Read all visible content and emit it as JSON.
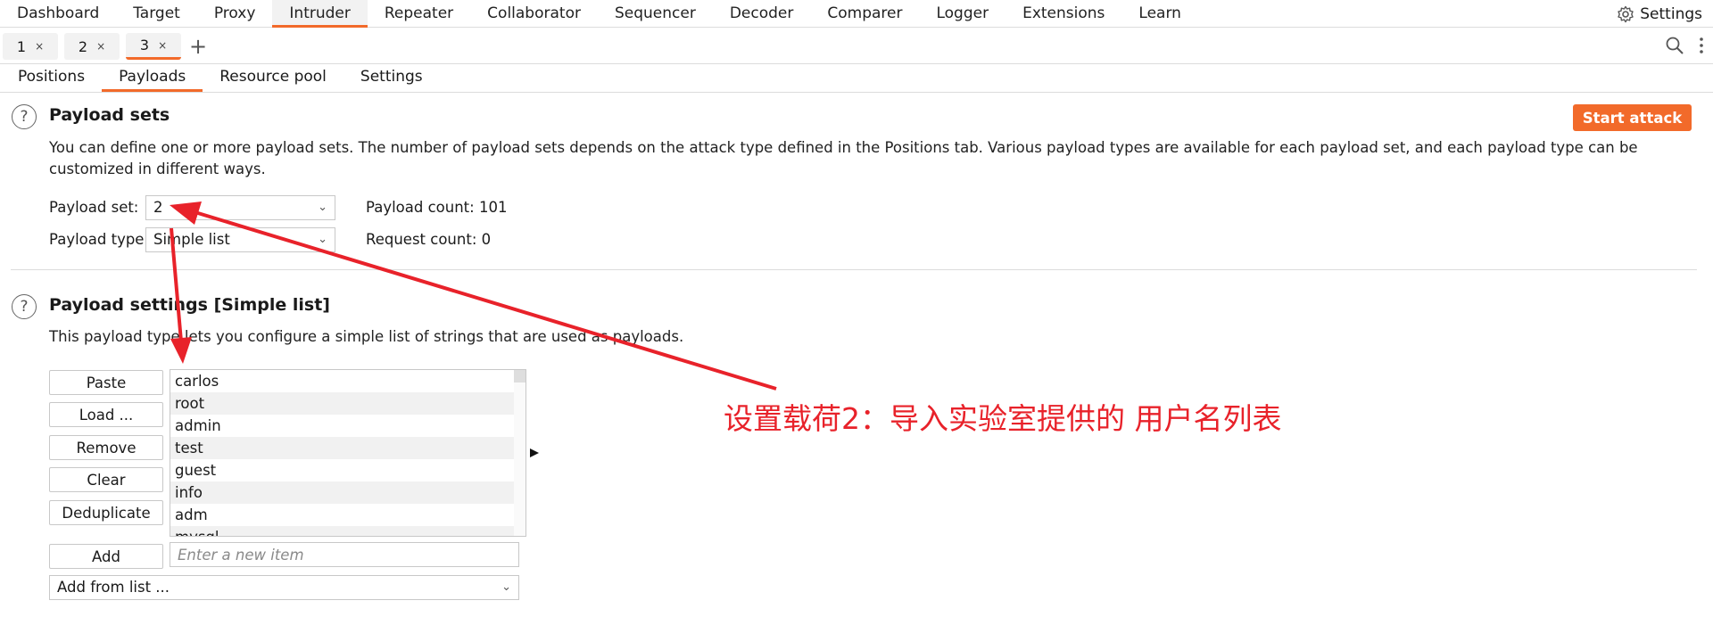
{
  "menu": [
    "Dashboard",
    "Target",
    "Proxy",
    "Intruder",
    "Repeater",
    "Collaborator",
    "Sequencer",
    "Decoder",
    "Comparer",
    "Logger",
    "Extensions",
    "Learn"
  ],
  "menu_active": "Intruder",
  "settings_label": "Settings",
  "attack_tabs": [
    {
      "label": "1",
      "close": "×"
    },
    {
      "label": "2",
      "close": "×"
    },
    {
      "label": "3",
      "close": "×"
    }
  ],
  "add_tab": "+",
  "subtabs": [
    "Positions",
    "Payloads",
    "Resource pool",
    "Settings"
  ],
  "subtab_active": "Payloads",
  "payload_sets": {
    "help": "?",
    "title": "Payload sets",
    "description": "You can define one or more payload sets. The number of payload sets depends on the attack type defined in the Positions tab. Various payload types are available for each payload set, and each payload type can be customized in different ways.",
    "start_attack": "Start attack",
    "set_label": "Payload set:",
    "set_value": "2",
    "type_label": "Payload type:",
    "type_value": "Simple list",
    "payload_count": "Payload count: 101",
    "request_count": "Request count: 0"
  },
  "payload_settings": {
    "help": "?",
    "title": "Payload settings [Simple list]",
    "description": "This payload type lets you configure a simple list of strings that are used as payloads.",
    "buttons": {
      "paste": "Paste",
      "load": "Load ...",
      "remove": "Remove",
      "clear": "Clear",
      "deduplicate": "Deduplicate",
      "add": "Add"
    },
    "items": [
      "carlos",
      "root",
      "admin",
      "test",
      "guest",
      "info",
      "adm",
      "mysql"
    ],
    "add_placeholder": "Enter a new item",
    "add_from_list": "Add from list ..."
  },
  "annotation": "设置载荷2：导入实验室提供的 用户名列表",
  "colors": {
    "accent": "#f26a2a",
    "annotation": "#e8222a"
  },
  "icons": [
    "gear-icon",
    "search-icon",
    "more-icon",
    "help-icon",
    "chevron-down-icon",
    "expand-arrow-icon"
  ]
}
